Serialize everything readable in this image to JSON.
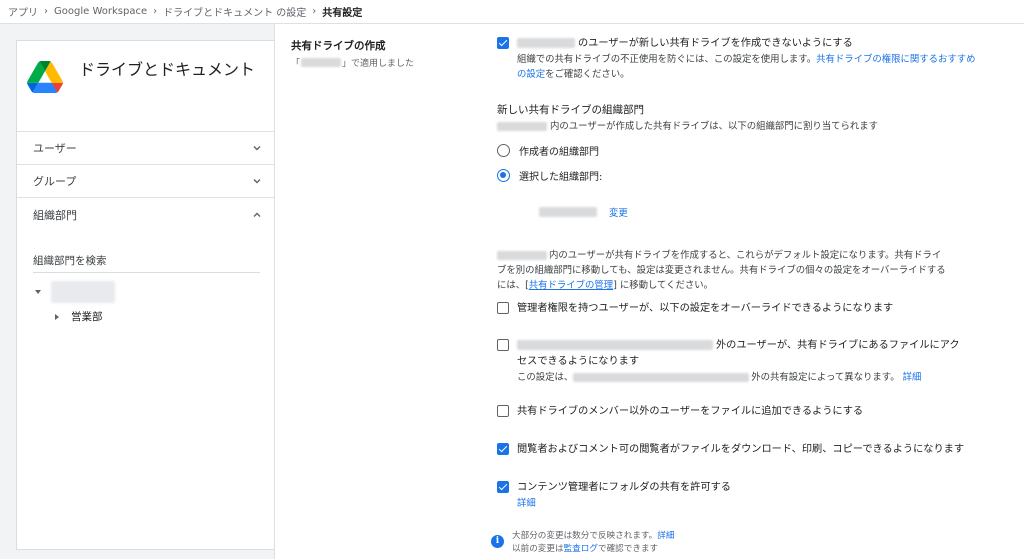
{
  "breadcrumb": {
    "items": [
      "アプリ",
      "Google Workspace",
      "ドライブとドキュメント の設定"
    ],
    "current": "共有設定"
  },
  "sidebar": {
    "app_title": "ドライブとドキュメント",
    "sections": [
      {
        "label": "ユーザー",
        "state": "collapsed"
      },
      {
        "label": "グループ",
        "state": "collapsed"
      },
      {
        "label": "組織部門",
        "state": "expanded"
      }
    ],
    "org_search_label": "組織部門を検索",
    "tree_child_label": "営業部"
  },
  "main": {
    "section_title": "共有ドライブの作成",
    "section_sub_prefix": "「",
    "section_sub_suffix": "」で適用しました",
    "opt1": {
      "checked": true,
      "label_suffix": "のユーザーが新しい共有ドライブを作成できないようにする",
      "desc": "組織での共有ドライブの不正使用を防ぐには、この設定を使用します。",
      "desc_link": "共有ドライブの権限に関するおすすめの設定",
      "desc_end": "をご確認ください。"
    },
    "new_ou_heading": "新しい共有ドライブの組織部門",
    "new_ou_desc": "内のユーザーが作成した共有ドライブは、以下の組織部門に割り当てられます",
    "radio_creator": "作成者の組織部門",
    "radio_selected": "選択した組織部門:",
    "change_link": "変更",
    "default_note_1": "内のユーザーが共有ドライブを作成すると、これらがデフォルト設定になります。共有ドライ",
    "default_note_2": "ブを別の組織部門に移動しても、設定は変更されません。共有ドライブの個々の設定をオーバーライドする",
    "default_note_3a": "には、[",
    "default_note_link": "共有ドライブの管理",
    "default_note_3b": "] に移動してください。",
    "opt2": {
      "checked": false,
      "label": "管理者権限を持つユーザーが、以下の設定をオーバーライドできるようになります"
    },
    "opt3": {
      "checked": false,
      "label_suffix_1": "外のユーザーが、共有ドライブにあるファイルにアク",
      "label_2": "セスできるようになります",
      "desc_prefix": "この設定は、",
      "desc_suffix": "外の共有設定によって異なります。",
      "detail_link": "詳細"
    },
    "opt4": {
      "checked": false,
      "label": "共有ドライブのメンバー以外のユーザーをファイルに追加できるようにする"
    },
    "opt5": {
      "checked": true,
      "label": "閲覧者およびコメント可の閲覧者がファイルをダウンロード、印刷、コピーできるようになります"
    },
    "opt6": {
      "checked": true,
      "label": "コンテンツ管理者にフォルダの共有を許可する",
      "detail_link": "詳細"
    },
    "info": {
      "line1": "大部分の変更は数分で反映されます。",
      "line1_link": "詳細",
      "line2_prefix": "以前の変更は",
      "line2_link": "監査ログ",
      "line2_suffix": "で確認できます"
    }
  },
  "colors": {
    "accent": "#1a73e8",
    "text": "#202124",
    "muted": "#5f6368"
  },
  "icons": [
    "google-drive-logo",
    "chevron-down-icon",
    "chevron-up-icon",
    "tree-expand-icon",
    "tree-collapsed-icon",
    "checkbox-checked-icon",
    "checkbox-empty-icon",
    "radio-icon",
    "info-icon"
  ]
}
